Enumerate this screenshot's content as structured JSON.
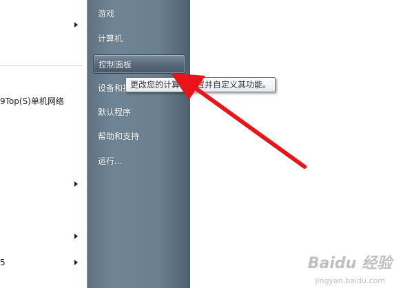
{
  "left_list": {
    "item_top_text": "",
    "item_mid_text": "9Top(S)单机网络",
    "item_bottom_text": "5"
  },
  "start_menu": {
    "items": [
      {
        "label": "游戏"
      },
      {
        "label": "计算机"
      },
      {
        "label": "控制面板"
      },
      {
        "label": "设备和打印机"
      },
      {
        "label": "默认程序"
      },
      {
        "label": "帮助和支持"
      },
      {
        "label": "运行..."
      }
    ],
    "hovered_index": 2
  },
  "tooltip": {
    "text": "更改您的计算机设置并自定义其功能。"
  },
  "colors": {
    "menu_bg": "#6a7f8f",
    "arrow": "#e8141a",
    "tooltip_border": "#767676"
  },
  "watermark": {
    "text": "Baidu 经验",
    "sub": "jingyan.baidu.com"
  }
}
